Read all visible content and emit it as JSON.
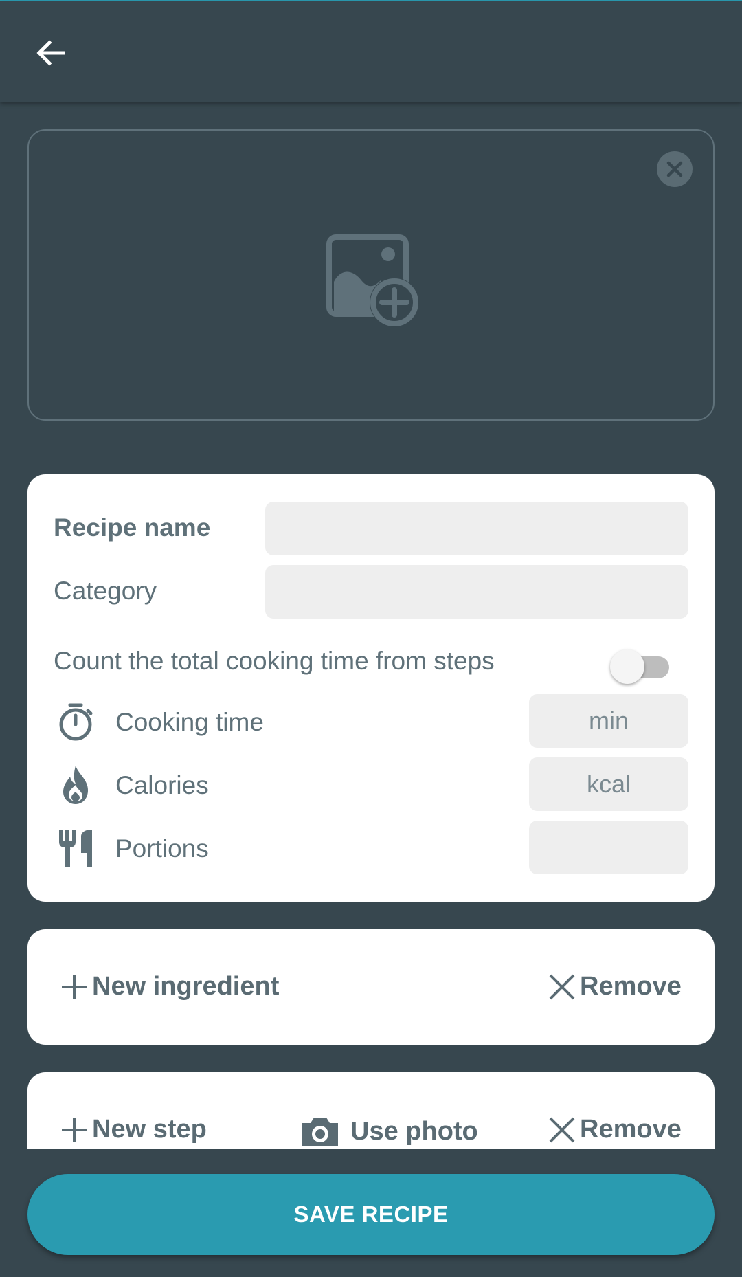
{
  "colors": {
    "background": "#37474f",
    "card": "#ffffff",
    "field": "#eeeeee",
    "label": "#5f7179",
    "accent": "#2a9bb0"
  },
  "appbar": {
    "back_icon": "arrow-back-icon"
  },
  "photo": {
    "add_icon": "add-photo-icon",
    "close_icon": "close-circle-icon"
  },
  "form": {
    "recipe_name_label": "Recipe name",
    "recipe_name_value": "",
    "category_label": "Category",
    "category_value": "",
    "auto_time_label": "Count the total cooking time from steps",
    "auto_time_enabled": false,
    "cooking_time_label": "Cooking time",
    "cooking_time_unit": "min",
    "calories_label": "Calories",
    "calories_unit": "kcal",
    "portions_label": "Portions",
    "portions_value": ""
  },
  "ingredients": {
    "new_label": "New ingredient",
    "remove_label": "Remove"
  },
  "steps": {
    "new_label": "New step",
    "photo_label": "Use photo",
    "remove_label": "Remove"
  },
  "save_label": "SAVE RECIPE"
}
